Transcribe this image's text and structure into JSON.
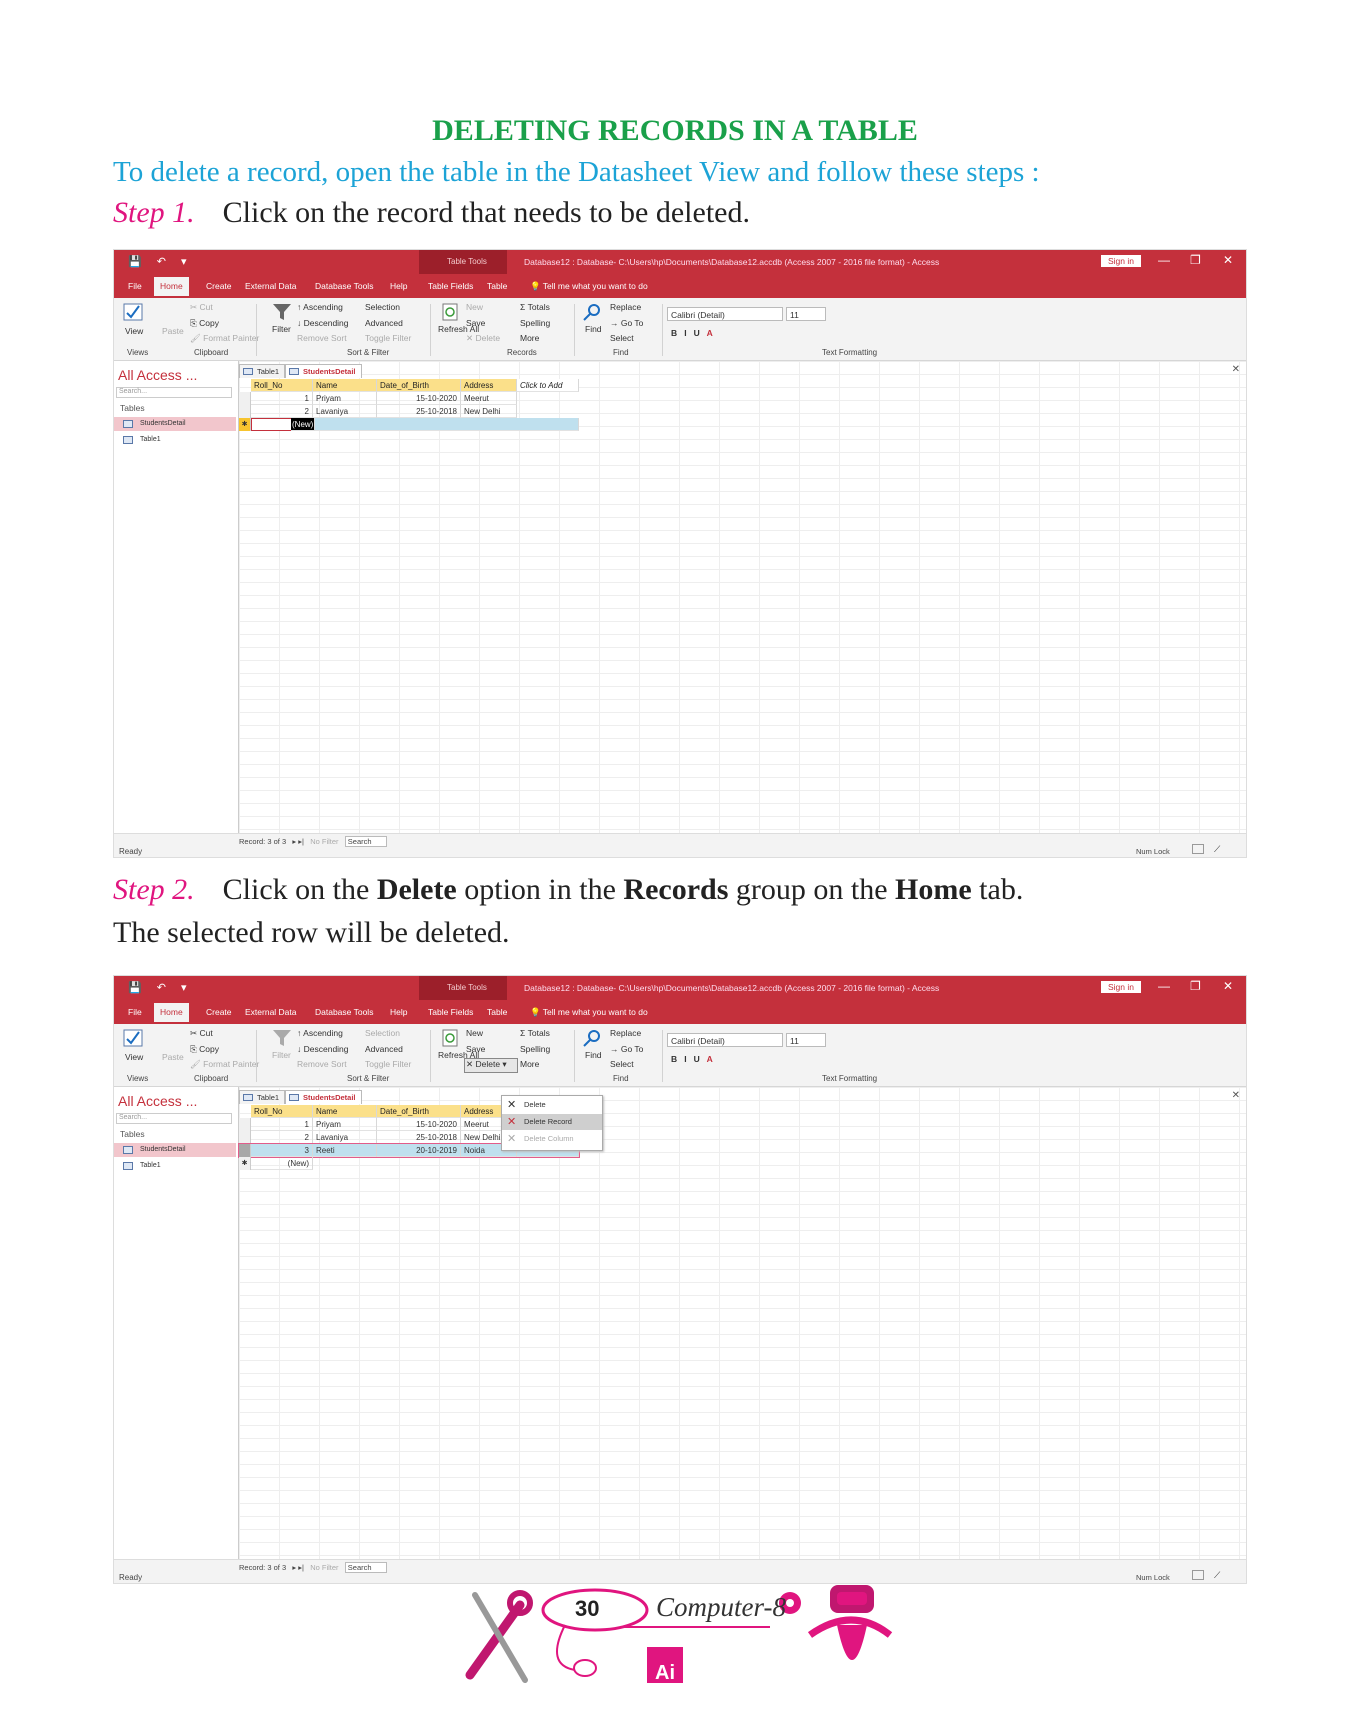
{
  "heading": "DELETING RECORDS IN A TABLE",
  "intro": "To delete a record, open the table in the Datasheet View and follow these steps :",
  "step1": {
    "label": "Step 1.",
    "text": "Click on the record that needs to be deleted."
  },
  "step2": {
    "label": "Step 2.",
    "text_pre": "Click on the ",
    "bold1": "Delete",
    "text_mid1": " option in the ",
    "bold2": "Records",
    "text_mid2": " group on the ",
    "bold3": "Home",
    "text_post": " tab."
  },
  "result": "The selected row will be deleted.",
  "access": {
    "table_tools": "Table Tools",
    "db_title": "Database12 : Database- C:\\Users\\hp\\Documents\\Database12.accdb (Access 2007 - 2016 file format) - Access",
    "sign_in": "Sign in",
    "tabs": [
      "File",
      "Home",
      "Create",
      "External Data",
      "Database Tools",
      "Help",
      "Table Fields",
      "Table"
    ],
    "tell_me": "Tell me what you want to do",
    "ribbon": {
      "view": "View",
      "paste": "Paste",
      "cut": "Cut",
      "copy": "Copy",
      "format_painter": "Format Painter",
      "filter": "Filter",
      "ascending": "Ascending",
      "descending": "Descending",
      "remove_sort": "Remove Sort",
      "selection": "Selection",
      "advanced": "Advanced",
      "toggle_filter": "Toggle Filter",
      "refresh": "Refresh All",
      "new": "New",
      "save": "Save",
      "delete": "Delete",
      "totals": "Totals",
      "spelling": "Spelling",
      "more": "More",
      "find": "Find",
      "replace": "Replace",
      "goto": "Go To",
      "select": "Select",
      "font": "Calibri (Detail)",
      "size": "11",
      "groups": [
        "Views",
        "Clipboard",
        "Sort & Filter",
        "Records",
        "Find",
        "Text Formatting"
      ]
    },
    "nav": {
      "title": "All Access ...",
      "search": "Search...",
      "header": "Tables",
      "items": [
        "StudentsDetail",
        "Table1"
      ]
    },
    "doc_tabs": [
      "Table1",
      "StudentsDetail"
    ],
    "columns": [
      "Roll_No",
      "Name",
      "Date_of_Birth",
      "Address",
      "Click to Add"
    ],
    "records_step1": [
      [
        "1",
        "Priyam",
        "15-10-2020",
        "Meerut"
      ],
      [
        "2",
        "Lavaniya",
        "25-10-2018",
        "New Delhi"
      ]
    ],
    "records_step2": [
      [
        "1",
        "Priyam",
        "15-10-2020",
        "Meerut"
      ],
      [
        "2",
        "Lavaniya",
        "25-10-2018",
        "New Delhi"
      ],
      [
        "3",
        "Reeti",
        "20-10-2019",
        "Noida"
      ]
    ],
    "new_row": "(New)",
    "record_nav": "Record: 3 of 3",
    "no_filter": "No Filter",
    "search_label": "Search",
    "ready": "Ready",
    "num_lock": "Num Lock",
    "delete_menu": [
      "Delete",
      "Delete Record",
      "Delete Column"
    ]
  },
  "footer": {
    "page": "30",
    "brand": "Computer-8",
    "logo": "Ai"
  }
}
